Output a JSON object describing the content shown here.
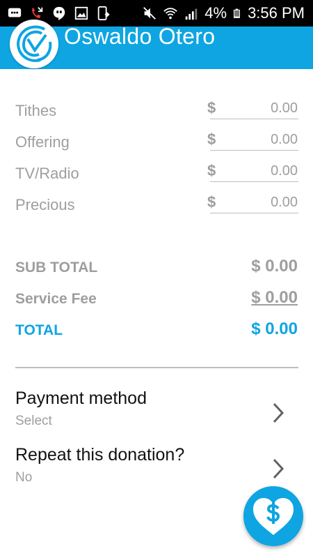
{
  "status_bar": {
    "battery": "4%",
    "time": "3:56 PM"
  },
  "header": {
    "title": "Oswaldo Otero"
  },
  "donations": [
    {
      "label": "Tithes",
      "currency": "$",
      "placeholder": "0.00"
    },
    {
      "label": "Offering",
      "currency": "$",
      "placeholder": "0.00"
    },
    {
      "label": "TV/Radio",
      "currency": "$",
      "placeholder": "0.00"
    },
    {
      "label": "Precious",
      "currency": "$",
      "placeholder": "0.00"
    }
  ],
  "summary": {
    "subtotal_label": "SUB TOTAL",
    "subtotal_value": "$ 0.00",
    "fee_label": "Service Fee",
    "fee_value": "$ 0.00",
    "total_label": "TOTAL",
    "total_value": "$ 0.00"
  },
  "options": {
    "payment_title": "Payment method",
    "payment_value": "Select",
    "repeat_title": "Repeat this donation?",
    "repeat_value": "No"
  },
  "colors": {
    "brand": "#0ea5e2",
    "muted": "#9e9e9e"
  }
}
